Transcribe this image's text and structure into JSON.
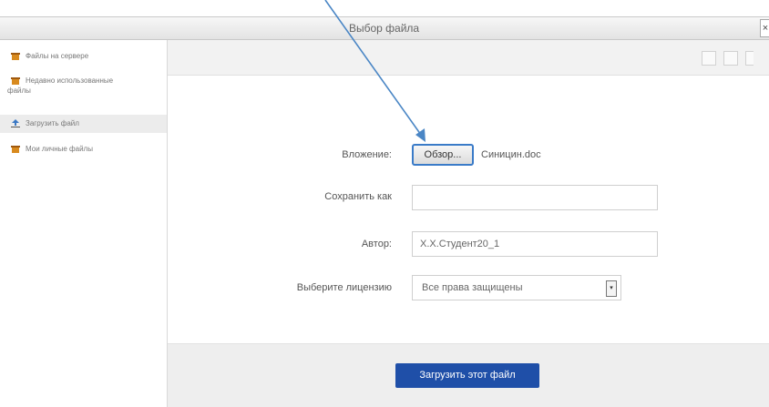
{
  "dialog": {
    "title": "Выбор файла",
    "close_label": "×"
  },
  "sidebar": {
    "items": [
      {
        "label": "Файлы на сервере",
        "icon": "repository-icon"
      },
      {
        "label": "Недавно использованные файлы",
        "icon": "recent-files-icon"
      },
      {
        "label": "Загрузить файл",
        "icon": "upload-icon",
        "active": true
      },
      {
        "label": "Мои личные файлы",
        "icon": "private-files-icon"
      }
    ]
  },
  "toolbar": {
    "view_buttons": [
      "grid-view-icon",
      "list-view-icon",
      "tree-view-icon"
    ]
  },
  "form": {
    "attachment_label": "Вложение:",
    "browse_label": "Обзор...",
    "selected_file": "Синицин.doc",
    "save_as_label": "Сохранить как",
    "save_as_value": "",
    "author_label": "Автор:",
    "author_value": "Х.Х.Студент20_1",
    "license_label": "Выберите лицензию",
    "license_value": "Все права защищены"
  },
  "footer": {
    "upload_label": "Загрузить этот файл"
  },
  "colors": {
    "primary": "#1f4fa8",
    "annotation_arrow": "#4a86c5"
  }
}
